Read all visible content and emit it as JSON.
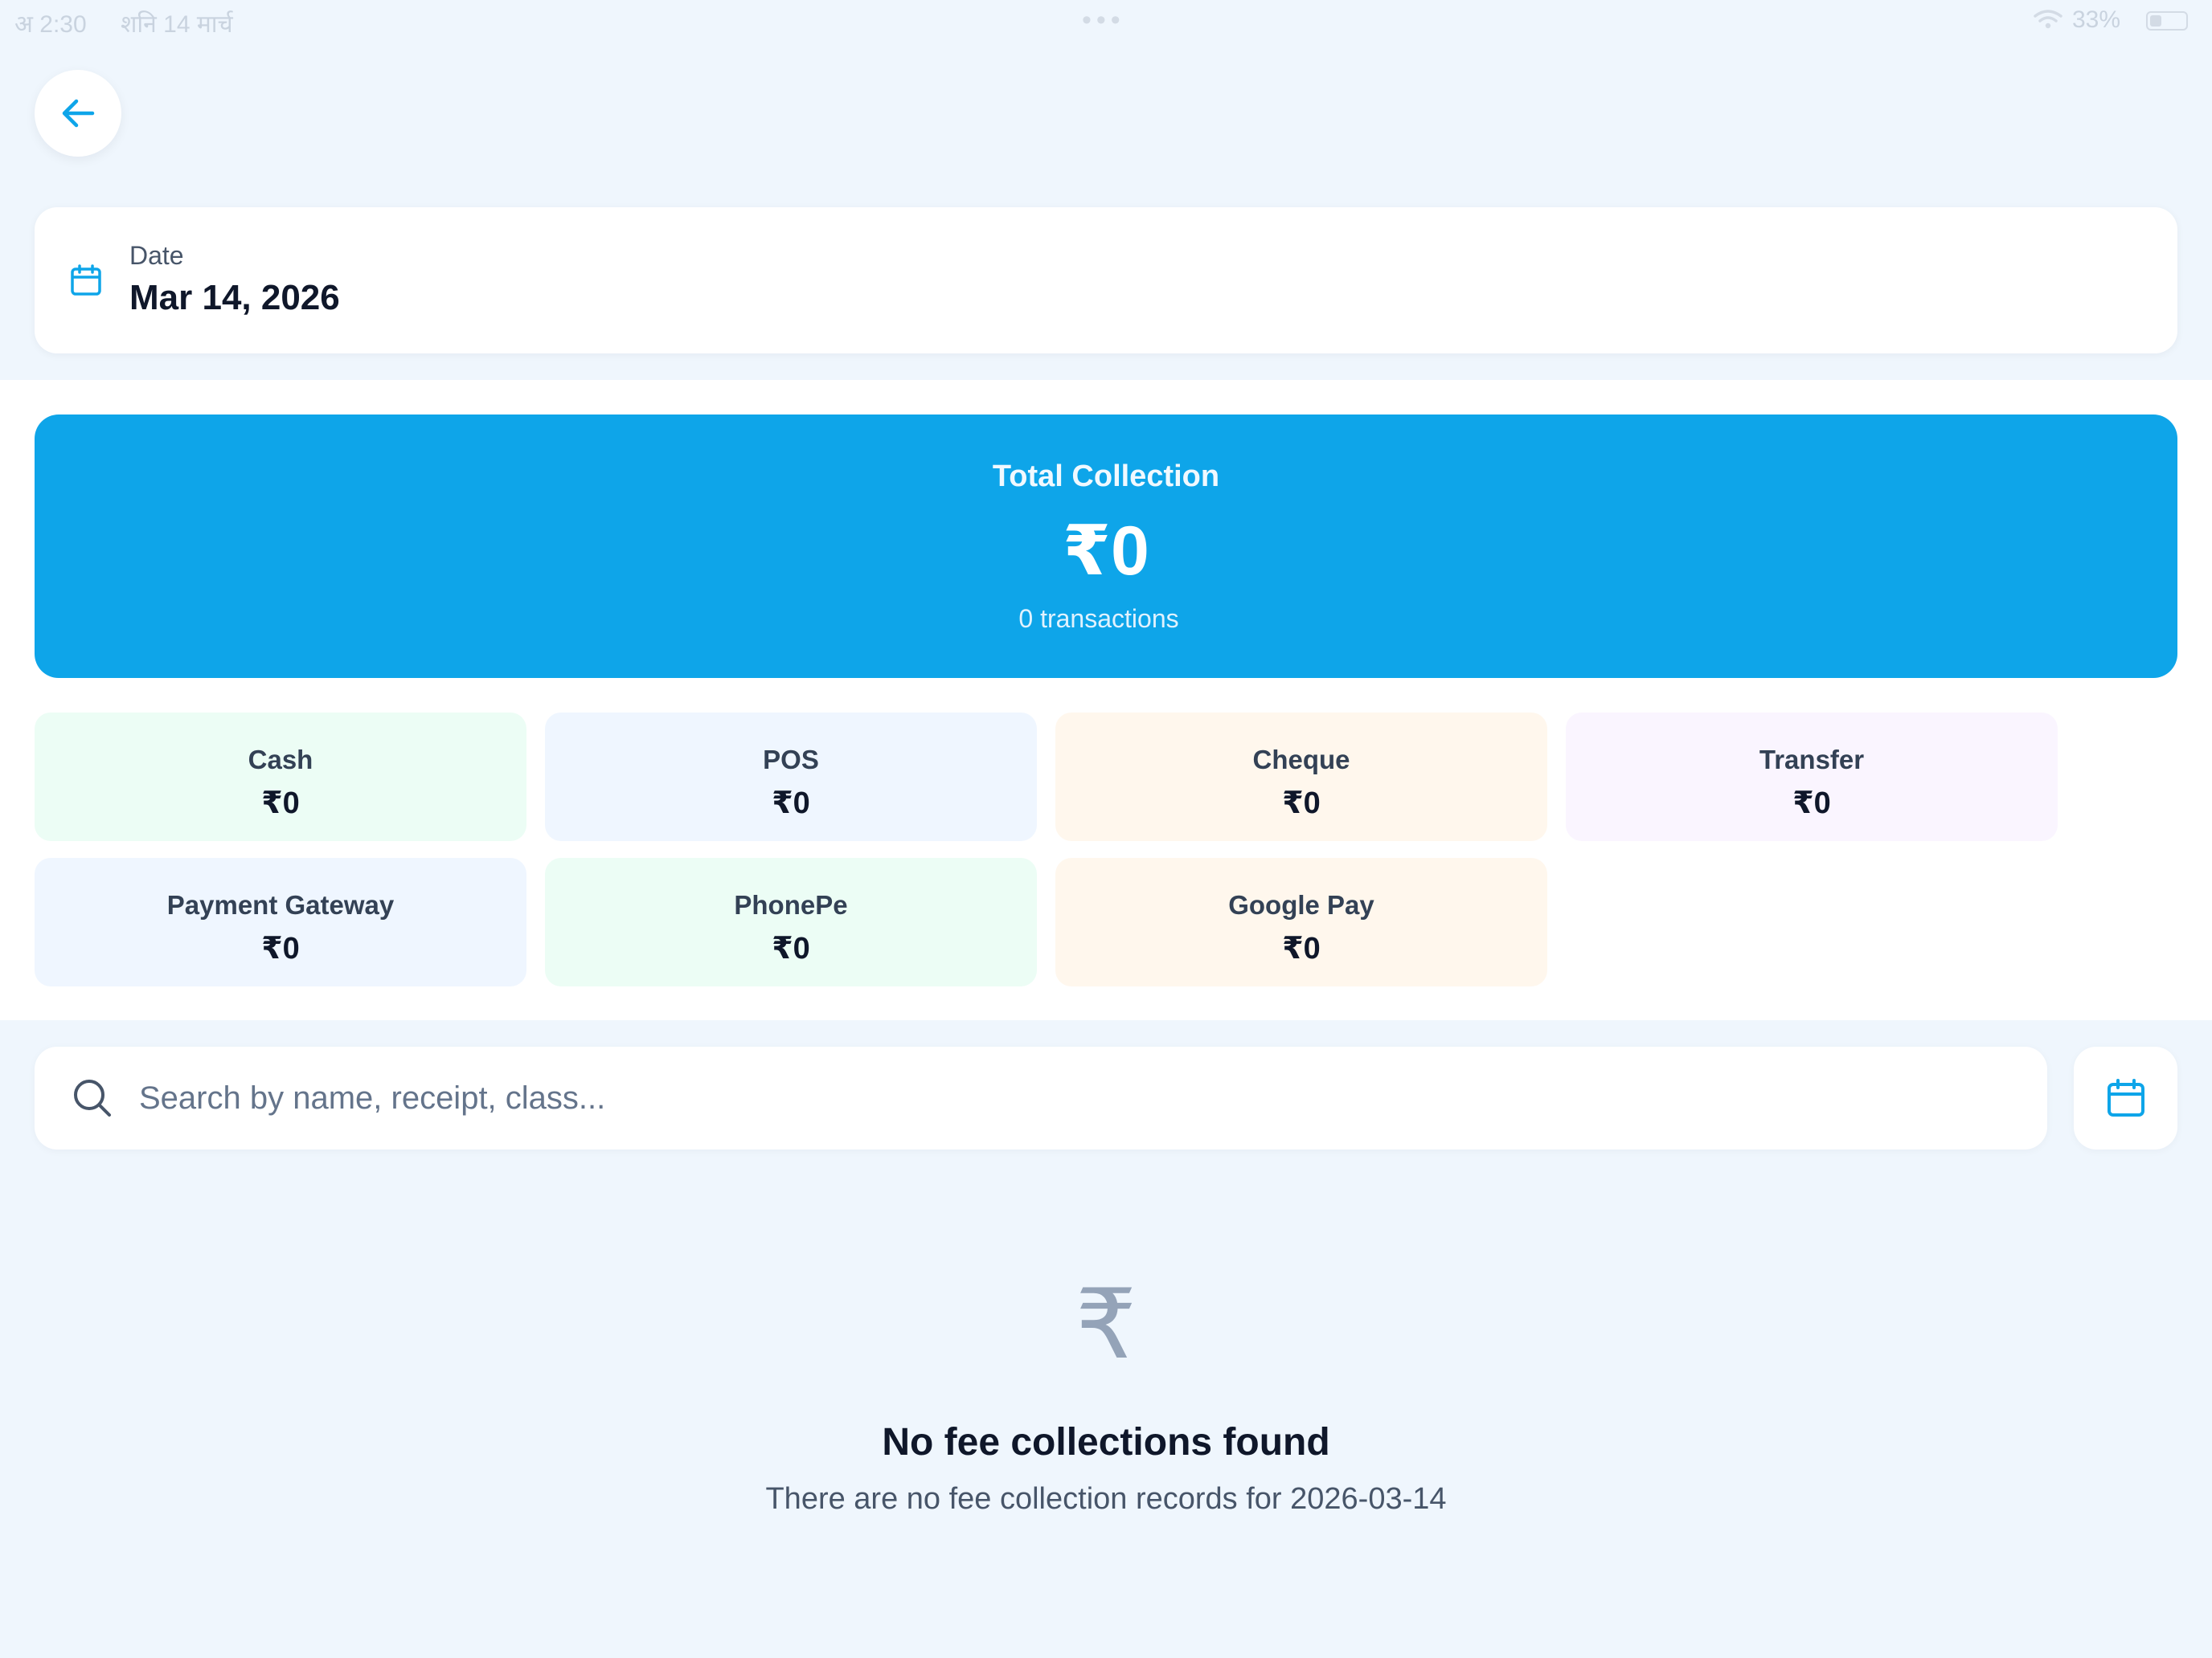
{
  "status_bar": {
    "time": "अ 2:30",
    "date": "शनि 14 मार्च",
    "dots": "•••",
    "battery": "33%",
    "battery_level": 0.33
  },
  "header": {
    "back_icon": "arrow-left-icon"
  },
  "date_card": {
    "label": "Date",
    "value": "Mar 14, 2026",
    "icon": "calendar-icon"
  },
  "summary": {
    "title": "Total Collection",
    "amount": "₹0",
    "transactions": "0 transactions",
    "color": "#0ea5e9"
  },
  "payment_methods": [
    {
      "label": "Cash",
      "amount": "₹0",
      "color": "#ecfdf5"
    },
    {
      "label": "POS",
      "amount": "₹0",
      "color": "#eff6ff"
    },
    {
      "label": "Cheque",
      "amount": "₹0",
      "color": "#fff7ed"
    },
    {
      "label": "Transfer",
      "amount": "₹0",
      "color": "#faf5ff"
    },
    {
      "label": "Payment Gateway",
      "amount": "₹0",
      "color": "#eff6ff"
    },
    {
      "label": "PhonePe",
      "amount": "₹0",
      "color": "#ecfdf5"
    },
    {
      "label": "Google Pay",
      "amount": "₹0",
      "color": "#fff7ed"
    }
  ],
  "search": {
    "placeholder": "Search by name, receipt, class...",
    "value": "",
    "icon": "search-icon",
    "filter_icon": "calendar-icon"
  },
  "empty_state": {
    "icon_glyph": "₹",
    "icon": "rupee-icon",
    "title": "No fee collections found",
    "message": "There are no fee collection records for 2026-03-14"
  }
}
